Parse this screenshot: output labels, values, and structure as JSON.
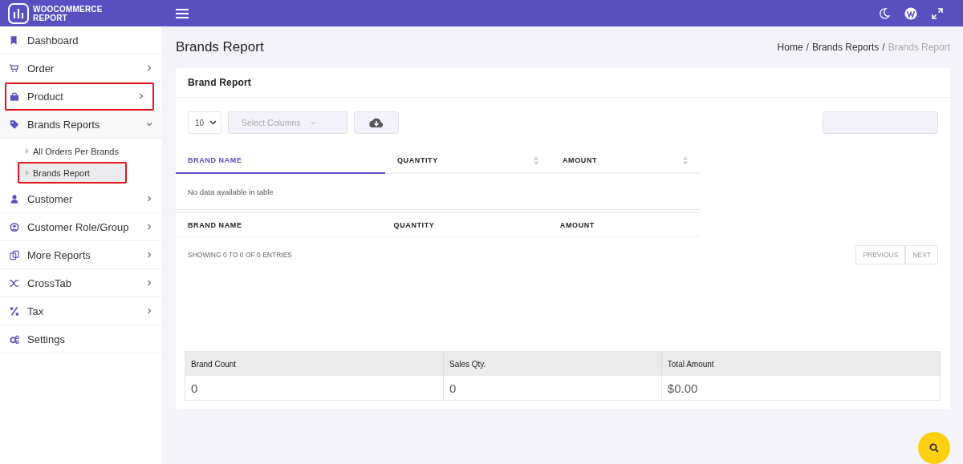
{
  "brand": {
    "line1": "WOOCOMMERCE",
    "line2": "REPORT"
  },
  "sidebar": {
    "items": [
      {
        "label": "Dashboard",
        "has_arrow": false,
        "highlighted": false
      },
      {
        "label": "Order",
        "has_arrow": true,
        "expanded": false,
        "highlighted": false
      },
      {
        "label": "Product",
        "has_arrow": true,
        "expanded": false,
        "highlighted": true
      },
      {
        "label": "Brands Reports",
        "has_arrow": true,
        "expanded": true,
        "highlighted": false,
        "children": [
          {
            "label": "All Orders Per Brands",
            "selected": false,
            "highlighted": false
          },
          {
            "label": "Brands Report",
            "selected": true,
            "highlighted": true
          }
        ]
      },
      {
        "label": "Customer",
        "has_arrow": true,
        "expanded": false,
        "highlighted": false
      },
      {
        "label": "Customer Role/Group",
        "has_arrow": true,
        "expanded": false,
        "highlighted": false
      },
      {
        "label": "More Reports",
        "has_arrow": true,
        "expanded": false,
        "highlighted": false
      },
      {
        "label": "CrossTab",
        "has_arrow": true,
        "expanded": false,
        "highlighted": false
      },
      {
        "label": "Tax",
        "has_arrow": true,
        "expanded": false,
        "highlighted": false
      },
      {
        "label": "Settings",
        "has_arrow": false,
        "highlighted": false
      }
    ]
  },
  "page_title": "Brands Report",
  "breadcrumb": {
    "separator": "/",
    "items": [
      {
        "label": "Home",
        "current": false
      },
      {
        "label": "Brands Reports",
        "current": false
      },
      {
        "label": "Brands Report",
        "current": true
      }
    ]
  },
  "card": {
    "title": "Brand Report",
    "page_length": "10",
    "column_select": {
      "placeholder": "Select Columns"
    },
    "table": {
      "columns": [
        {
          "label": "BRAND NAME",
          "sorted": true
        },
        {
          "label": "QUANTITY",
          "sorted": false
        },
        {
          "label": "AMOUNT",
          "sorted": false
        }
      ],
      "empty_message": "No data available in table",
      "footer": [
        "BRAND NAME",
        "QUANTITY",
        "AMOUNT"
      ]
    },
    "info": "SHOWING 0 TO 0 OF 0 ENTRIES",
    "pager": [
      {
        "label": "PREVIOUS",
        "disabled": true
      },
      {
        "label": "NEXT",
        "disabled": true
      }
    ],
    "summary": {
      "columns": [
        "Brand Count",
        "Sales Qty.",
        "Total Amount"
      ],
      "values": [
        "0",
        "0",
        "$0.00"
      ]
    }
  }
}
